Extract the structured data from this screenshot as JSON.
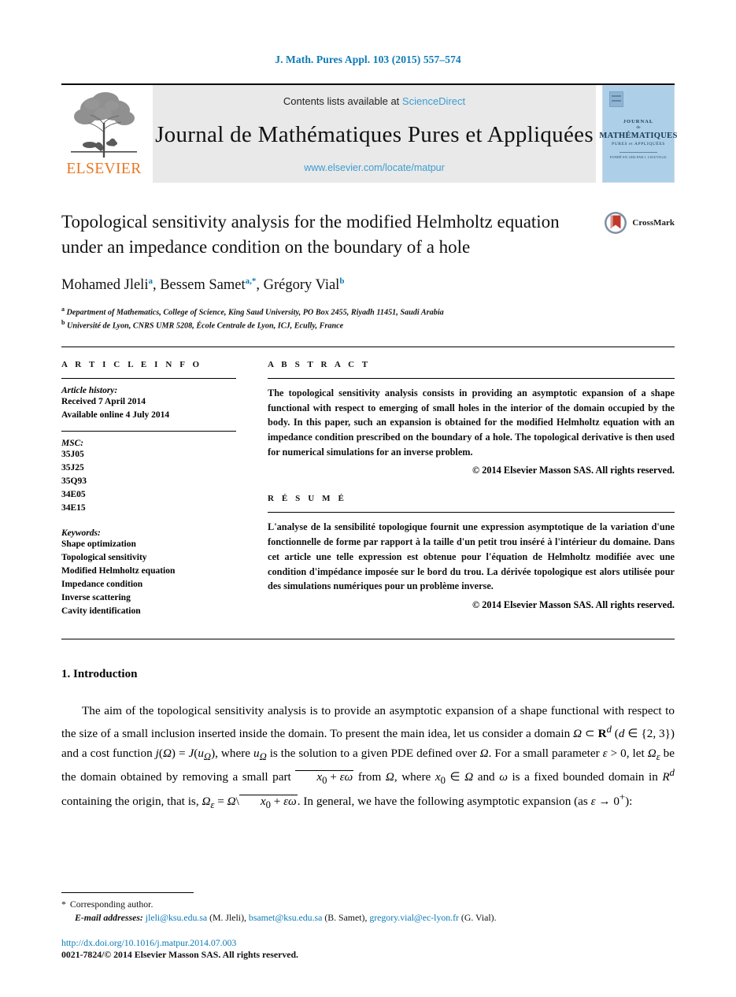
{
  "running_head": "J. Math. Pures Appl. 103 (2015) 557–574",
  "masthead": {
    "publisher_name": "ELSEVIER",
    "contents_prefix": "Contents lists available at",
    "contents_link": "ScienceDirect",
    "journal_name": "Journal de Mathématiques Pures et Appliquées",
    "journal_url": "www.elsevier.com/locate/matpur",
    "cover": {
      "line1": "JOURNAL",
      "line2": "de",
      "line3": "MATHÉMATIQUES",
      "line4": "PURES et APPLIQUÉES",
      "line5": "FONDÉ EN 1836 PAR J. LIOUVILLE"
    }
  },
  "article": {
    "title": "Topological sensitivity analysis for the modified Helmholtz equation under an impedance condition on the boundary of a hole",
    "crossmark_label": "CrossMark",
    "authors_html": "Mohamed Jleli<sup>a</sup>, Bessem Samet<sup>a,*</sup>, Grégory Vial<sup>b</sup>",
    "affiliations": [
      {
        "marker": "a",
        "text": "Department of Mathematics, College of Science, King Saud University, PO Box 2455, Riyadh 11451, Saudi Arabia"
      },
      {
        "marker": "b",
        "text": "Université de Lyon, CNRS UMR 5208, École Centrale de Lyon, ICJ, Ecully, France"
      }
    ]
  },
  "info": {
    "heading": "A R T I C L E   I N F O",
    "history_label": "Article history:",
    "history": [
      "Received 7 April 2014",
      "Available online 4 July 2014"
    ],
    "msc_label": "MSC:",
    "msc": [
      "35J05",
      "35J25",
      "35Q93",
      "34E05",
      "34E15"
    ],
    "keywords_label": "Keywords:",
    "keywords": [
      "Shape optimization",
      "Topological sensitivity",
      "Modified Helmholtz equation",
      "Impedance condition",
      "Inverse scattering",
      "Cavity identification"
    ]
  },
  "abstract": {
    "heading": "A B S T R A C T",
    "text": "The topological sensitivity analysis consists in providing an asymptotic expansion of a shape functional with respect to emerging of small holes in the interior of the domain occupied by the body. In this paper, such an expansion is obtained for the modified Helmholtz equation with an impedance condition prescribed on the boundary of a hole. The topological derivative is then used for numerical simulations for an inverse problem.",
    "copyright": "© 2014 Elsevier Masson SAS. All rights reserved."
  },
  "resume": {
    "heading": "R É S U M É",
    "text": "L'analyse de la sensibilité topologique fournit une expression asymptotique de la variation d'une fonctionnelle de forme par rapport à la taille d'un petit trou inséré à l'intérieur du domaine. Dans cet article une telle expression est obtenue pour l'équation de Helmholtz modifiée avec une condition d'impédance imposée sur le bord du trou. La dérivée topologique est alors utilisée pour des simulations numériques pour un problème inverse.",
    "copyright": "© 2014 Elsevier Masson SAS. All rights reserved."
  },
  "body": {
    "section_number_title": "1.  Introduction",
    "paragraph_html": "The aim of the topological sensitivity analysis is to provide an asymptotic expansion of a shape functional with respect to the size of a small inclusion inserted inside the domain. To present the main idea, let us consider a domain <i>Ω</i> ⊂ <span class=\"bb\">R</span><sup><i>d</i></sup> (<i>d</i> ∈ {2, 3}) and a cost function <i>j</i>(<i>Ω</i>) = <i>J</i>(<i>u<sub>Ω</sub></i>), where <i>u<sub>Ω</sub></i> is the solution to a given PDE defined over <i>Ω</i>. For a small parameter <i>ε</i> &gt; 0, let <i>Ω<sub>ε</sub></i> be the domain obtained by removing a small part <span class=\"ovl\"><i>x</i><sub>0</sub> + <i>εω</i></span> from <i>Ω</i>, where <i>x</i><sub>0</sub> ∈ <i>Ω</i> and <i>ω</i> is a fixed bounded domain in <i>R<sup>d</sup></i> containing the origin, that is, <i>Ω<sub>ε</sub></i> = <i>Ω</i>\\<span class=\"ovl\"><i>x</i><sub>0</sub> + <i>εω</i></span>. In general, we have the following asymptotic expansion (as <i>ε</i> → 0<sup>+</sup>):"
  },
  "footer": {
    "corresponding_star": "*",
    "corresponding_text": "Corresponding author.",
    "email_label": "E-mail addresses:",
    "emails": [
      {
        "address": "jleli@ksu.edu.sa",
        "owner": "(M. Jleli)"
      },
      {
        "address": "bsamet@ksu.edu.sa",
        "owner": "(B. Samet)"
      },
      {
        "address": "gregory.vial@ec-lyon.fr",
        "owner": "(G. Vial)"
      }
    ],
    "doi": "http://dx.doi.org/10.1016/j.matpur.2014.07.003",
    "issn_line": "0021-7824/© 2014 Elsevier Masson SAS. All rights reserved."
  },
  "colors": {
    "link": "#0b7ab5",
    "sciencedirect": "#3b9dd2",
    "elsevier_orange": "#e87722",
    "cover_blue": "#aecfe8"
  }
}
